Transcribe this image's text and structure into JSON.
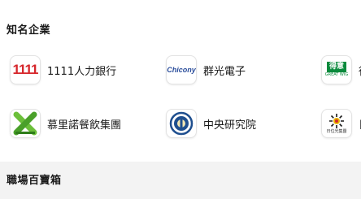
{
  "sections": {
    "famous_companies_title": "知名企業",
    "workplace_title": "職場百寶箱"
  },
  "companies": [
    {
      "name": "1111人力銀行",
      "logo_text": "1111",
      "icon": "1111-logo-icon"
    },
    {
      "name": "群光電子",
      "logo_text": "Chicony",
      "icon": "chicony-logo-icon"
    },
    {
      "name": "得",
      "logo_text": "得意",
      "logo_subtext": "GREAT WIG",
      "icon": "great-wig-logo-icon"
    },
    {
      "name": "慕里諾餐飲集團",
      "logo_text": "",
      "icon": "murino-logo-icon"
    },
    {
      "name": "中央研究院",
      "logo_text": "",
      "icon": "academia-sinica-logo-icon"
    },
    {
      "name": "日",
      "logo_text": "日位光集團",
      "icon": "sun-group-logo-icon"
    }
  ],
  "colors": {
    "brand_red": "#d6262b",
    "chicony_blue": "#2a4d9b",
    "great_wig_green": "#0a8a3c",
    "murino_green": "#6bbf3a",
    "sinica_blue": "#1f4f8f",
    "footer_bg": "#f3f3f3"
  }
}
